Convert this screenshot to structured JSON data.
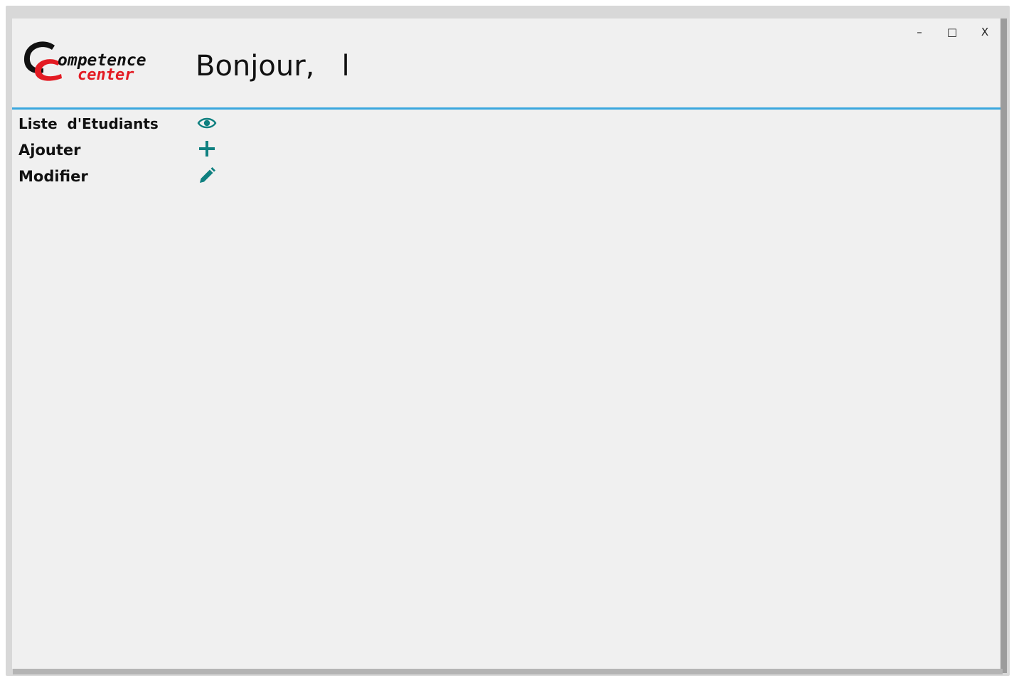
{
  "window": {
    "controls": {
      "minimize": "–",
      "maximize": "□",
      "close": "X"
    }
  },
  "header": {
    "logo": {
      "text_line1": "ompetence",
      "text_line2": "center",
      "colors": {
        "black": "#111111",
        "red": "#e31b23"
      }
    },
    "greeting": "Bonjour,   l"
  },
  "divider_color": "#3aa7de",
  "menu": {
    "items": [
      {
        "label": "Liste  d'Etudiants",
        "icon": "eye-icon"
      },
      {
        "label": "Ajouter",
        "icon": "plus-icon"
      },
      {
        "label": "Modifier",
        "icon": "pencil-icon"
      }
    ],
    "icon_color": "#0f8080"
  }
}
